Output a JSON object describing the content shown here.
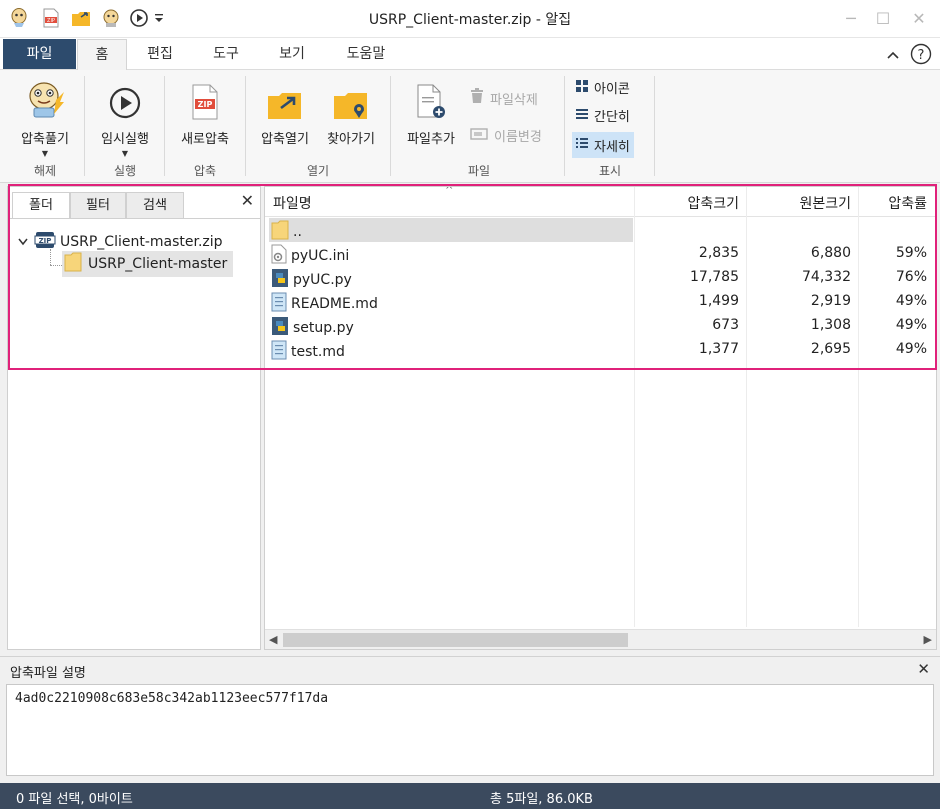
{
  "window": {
    "title": "USRP_Client-master.zip - 알집"
  },
  "menu": {
    "file": "파일",
    "tabs": [
      "홈",
      "편집",
      "도구",
      "보기",
      "도움말"
    ]
  },
  "ribbon": {
    "extract": "압축풀기",
    "extract_group": "해제",
    "run": "임시실행",
    "run_group": "실행",
    "new_zip": "새로압축",
    "new_zip_group": "압축",
    "open_zip": "압축열기",
    "browse": "찾아가기",
    "open_group": "열기",
    "add_file": "파일추가",
    "delete_file": "파일삭제",
    "rename": "이름변경",
    "file_group": "파일",
    "view_icons": "아이콘",
    "view_simple": "간단히",
    "view_detail": "자세히",
    "view_group": "표시"
  },
  "left": {
    "tabs": [
      "폴더",
      "필터",
      "검색"
    ],
    "tree_root": "USRP_Client-master.zip",
    "tree_child": "USRP_Client-master"
  },
  "list": {
    "columns": [
      "파일명",
      "압축크기",
      "원본크기",
      "압축률"
    ],
    "up": "..",
    "rows": [
      {
        "name": "pyUC.ini",
        "icon": "ini-file-icon",
        "packed": "2,835",
        "original": "6,880",
        "ratio": "59%"
      },
      {
        "name": "pyUC.py",
        "icon": "python-file-icon",
        "packed": "17,785",
        "original": "74,332",
        "ratio": "76%"
      },
      {
        "name": "README.md",
        "icon": "text-file-icon",
        "packed": "1,499",
        "original": "2,919",
        "ratio": "49%"
      },
      {
        "name": "setup.py",
        "icon": "python-file-icon",
        "packed": "673",
        "original": "1,308",
        "ratio": "49%"
      },
      {
        "name": "test.md",
        "icon": "text-file-icon",
        "packed": "1,377",
        "original": "2,695",
        "ratio": "49%"
      }
    ]
  },
  "comment": {
    "title": "압축파일 설명",
    "text": "4ad0c2210908c683e58c342ab1123eec577f17da"
  },
  "status": {
    "left": "0 파일 선택,  0바이트",
    "center": "총 5파일,  86.0KB"
  },
  "colors": {
    "accent": "#2d4b6d",
    "highlight": "#e0217a",
    "statusbar": "#3b4a5e",
    "selection": "#cde3f7"
  }
}
